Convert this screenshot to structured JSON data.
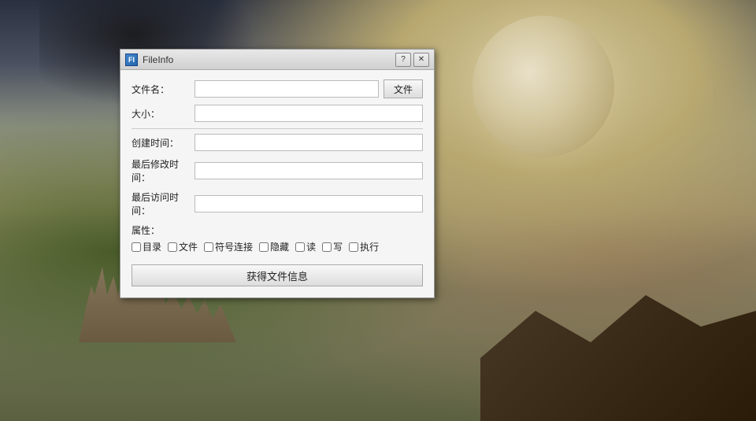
{
  "background": {
    "description": "Fantasy RPG landscape with dragon, moon, castle, figure on cliff"
  },
  "dialog": {
    "title": "FileInfo",
    "icon_label": "FI",
    "help_btn": "?",
    "close_btn": "✕",
    "fields": {
      "filename_label": "文件名：",
      "filename_value": "",
      "filename_placeholder": "",
      "size_label": "大小：",
      "size_value": "",
      "created_label": "创建时间：",
      "created_value": "",
      "modified_label": "最后修改时间：",
      "modified_value": "",
      "accessed_label": "最后访问时间：",
      "accessed_value": "",
      "attrs_label": "属性："
    },
    "file_button": "文件",
    "checkboxes": [
      {
        "label": "目录",
        "checked": false
      },
      {
        "label": "文件",
        "checked": false
      },
      {
        "label": "符号连接",
        "checked": false
      },
      {
        "label": "隐藏",
        "checked": false
      },
      {
        "label": "读",
        "checked": false
      },
      {
        "label": "写",
        "checked": false
      },
      {
        "label": "执行",
        "checked": false
      }
    ],
    "get_info_button": "获得文件信息"
  }
}
